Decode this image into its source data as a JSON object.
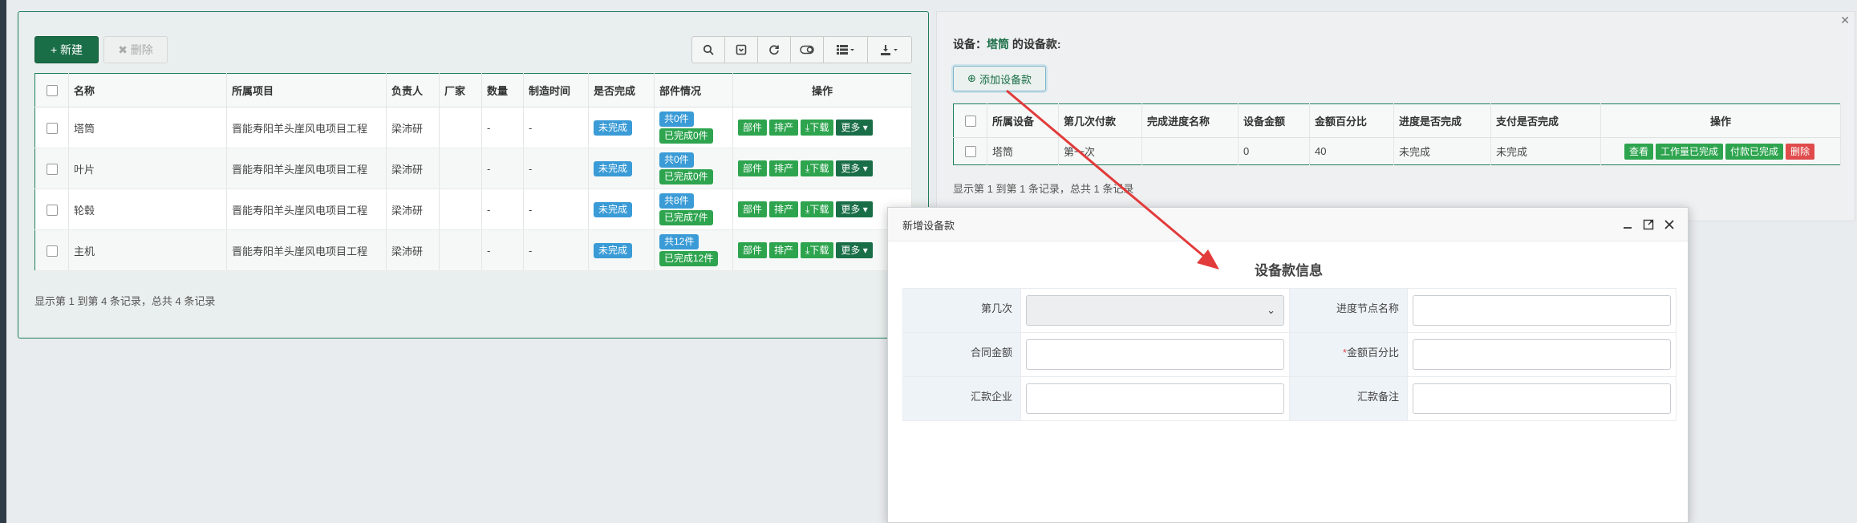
{
  "left": {
    "new_btn": "+ 新建",
    "delete_btn": "✖ 删除",
    "toolbar": [
      "search-icon",
      "toggle-icon",
      "refresh-icon",
      "columns-icon",
      "list-icon",
      "export-icon"
    ],
    "columns": [
      "名称",
      "所属项目",
      "负责人",
      "厂家",
      "数量",
      "制造时间",
      "是否完成",
      "部件情况",
      "操作"
    ],
    "rows": [
      {
        "name": "塔筒",
        "project": "晋能寿阳羊头崖风电项目工程",
        "owner": "梁沛研",
        "vendor": "",
        "qty": "-",
        "time": "-",
        "done": "未完成",
        "parts_total": "共0件",
        "parts_done": "已完成0件"
      },
      {
        "name": "叶片",
        "project": "晋能寿阳羊头崖风电项目工程",
        "owner": "梁沛研",
        "vendor": "",
        "qty": "-",
        "time": "-",
        "done": "未完成",
        "parts_total": "共0件",
        "parts_done": "已完成0件"
      },
      {
        "name": "轮毂",
        "project": "晋能寿阳羊头崖风电项目工程",
        "owner": "梁沛研",
        "vendor": "",
        "qty": "-",
        "time": "-",
        "done": "未完成",
        "parts_total": "共8件",
        "parts_done": "已完成7件"
      },
      {
        "name": "主机",
        "project": "晋能寿阳羊头崖风电项目工程",
        "owner": "梁沛研",
        "vendor": "",
        "qty": "-",
        "time": "-",
        "done": "未完成",
        "parts_total": "共12件",
        "parts_done": "已完成12件"
      }
    ],
    "row_actions": {
      "parts": "部件",
      "schedule": "排产",
      "download": "下载",
      "more": "更多"
    },
    "footer": "显示第 1 到第 4 条记录，总共 4 条记录"
  },
  "right": {
    "title_prefix": "设备：",
    "title_name": "塔筒",
    "title_suffix": " 的设备款:",
    "add_btn": "添加设备款",
    "columns": [
      "所属设备",
      "第几次付款",
      "完成进度名称",
      "设备金额",
      "金额百分比",
      "进度是否完成",
      "支付是否完成",
      "操作"
    ],
    "row": {
      "device": "塔筒",
      "nth": "第一次",
      "progress_name": "",
      "amount": "0",
      "percent": "40",
      "progress_done": "未完成",
      "pay_done": "未完成"
    },
    "row_actions": {
      "view": "查看",
      "work_done": "工作量已完成",
      "pay_done": "付款已完成",
      "delete": "删除"
    },
    "footer": "显示第 1 到第 1 条记录，总共 1 条记录"
  },
  "modal": {
    "title": "新增设备款",
    "form_title": "设备款信息",
    "labels": {
      "nth": "第几次",
      "progress_node": "进度节点名称",
      "contract_amount": "合同金额",
      "percent": "金额百分比",
      "remit_company": "汇款企业",
      "remit_note": "汇款备注"
    },
    "required_mark": "*"
  },
  "colors": {
    "primary": "#1a6e47",
    "success": "#2ea44f",
    "info": "#3a9bd6",
    "danger": "#e04b4b",
    "arrow": "#e23b3b"
  }
}
